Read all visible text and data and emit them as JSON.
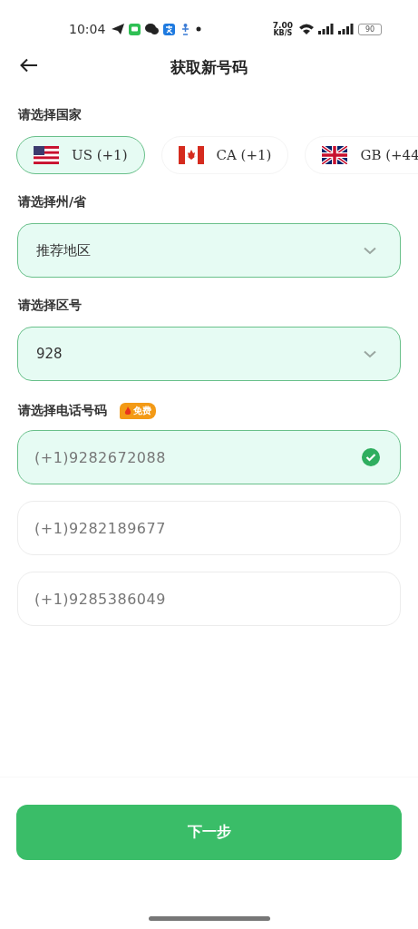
{
  "status_bar": {
    "time": "10:04",
    "net_speed": "7.00",
    "net_unit": "KB/S",
    "battery": "90"
  },
  "header": {
    "title": "获取新号码"
  },
  "country": {
    "label": "请选择国家",
    "options": [
      {
        "label": "US (+1)",
        "kind": "us",
        "selected": true
      },
      {
        "label": "CA (+1)",
        "kind": "ca",
        "selected": false
      },
      {
        "label": "GB (+44",
        "kind": "gb",
        "selected": false
      }
    ]
  },
  "state": {
    "label": "请选择州/省",
    "value": "推荐地区"
  },
  "area_code": {
    "label": "请选择区号",
    "value": "928"
  },
  "phone": {
    "label": "请选择电话号码",
    "badge": "免费",
    "options": [
      {
        "number": "(+1)9282672088",
        "selected": true
      },
      {
        "number": "(+1)9282189677",
        "selected": false
      },
      {
        "number": "(+1)9285386049",
        "selected": false
      }
    ]
  },
  "next_button": "下一步"
}
